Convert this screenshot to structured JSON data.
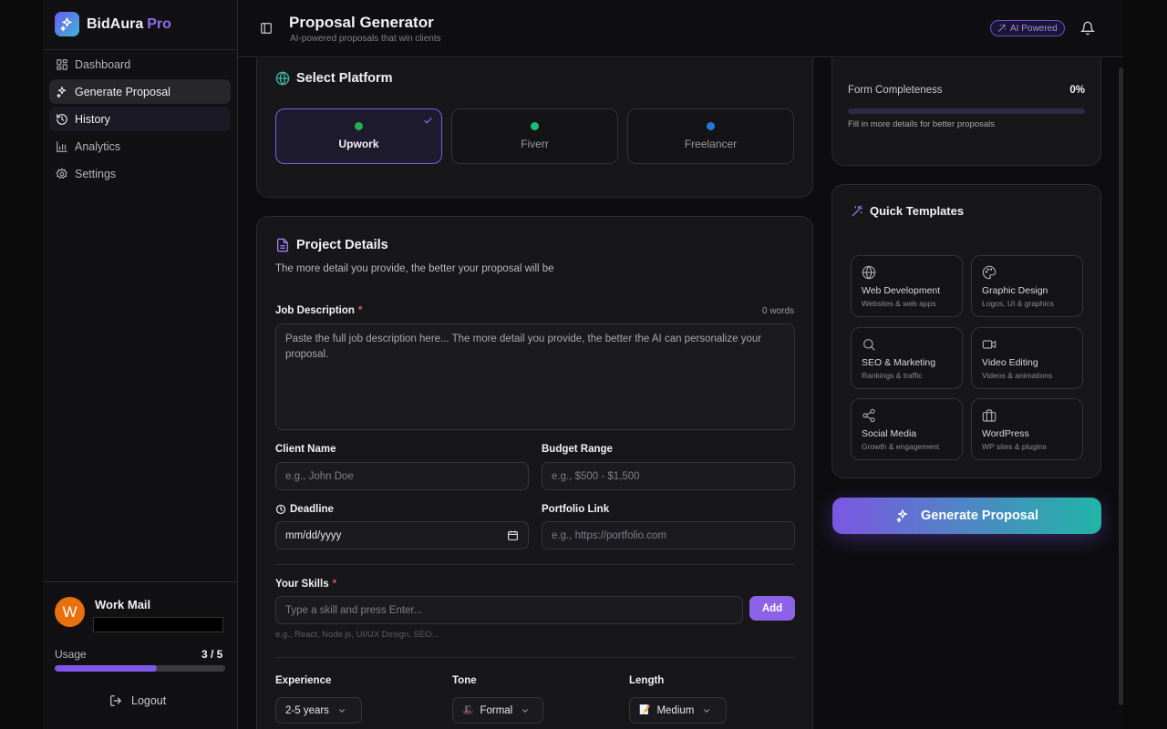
{
  "brand": {
    "name": "BidAura",
    "tier": "Pro"
  },
  "sidebar": {
    "items": [
      {
        "label": "Dashboard",
        "icon": "dashboard-icon"
      },
      {
        "label": "Generate Proposal",
        "icon": "sparkles-icon"
      },
      {
        "label": "History",
        "icon": "history-icon"
      },
      {
        "label": "Analytics",
        "icon": "chart-icon"
      },
      {
        "label": "Settings",
        "icon": "gear-icon"
      }
    ],
    "user": {
      "initial": "W",
      "name": "Work Mail"
    },
    "usage": {
      "label": "Usage",
      "count": "3 / 5",
      "fraction": 0.6
    },
    "logout_label": "Logout"
  },
  "header": {
    "title": "Proposal Generator",
    "subtitle": "AI-powered proposals that win clients",
    "badge": "AI Powered"
  },
  "platform": {
    "title": "Select Platform",
    "options": [
      {
        "label": "Upwork",
        "color": "#22b14c",
        "selected": true
      },
      {
        "label": "Fiverr",
        "color": "#1dbf73",
        "selected": false
      },
      {
        "label": "Freelancer",
        "color": "#1f7cd6",
        "selected": false
      }
    ]
  },
  "project": {
    "title": "Project Details",
    "description": "The more detail you provide, the better your proposal will be",
    "job_description": {
      "label": "Job Description",
      "required_mark": "*",
      "word_count": "0 words",
      "placeholder": "Paste the full job description here... The more detail you provide, the better the AI can personalize your proposal."
    },
    "client_name": {
      "label": "Client Name",
      "placeholder": "e.g., John Doe"
    },
    "budget_range": {
      "label": "Budget Range",
      "placeholder": "e.g., $500 - $1,500"
    },
    "deadline": {
      "label": "Deadline",
      "value": "mm/dd/yyyy"
    },
    "portfolio": {
      "label": "Portfolio Link",
      "placeholder": "e.g., https://portfolio.com"
    },
    "skills": {
      "label": "Your Skills",
      "required_mark": "*",
      "placeholder": "Type a skill and press Enter...",
      "add_label": "Add",
      "hint": "e.g., React, Node.js, UI/UX Design, SEO..."
    },
    "experience": {
      "label": "Experience",
      "value": "2-5 years"
    },
    "tone": {
      "label": "Tone",
      "value": "Formal",
      "emoji": "🎩"
    },
    "length": {
      "label": "Length",
      "value": "Medium",
      "emoji": "📝"
    }
  },
  "completeness": {
    "label": "Form Completeness",
    "value": "0%",
    "fraction": 0,
    "hint": "Fill in more details for better proposals"
  },
  "templates": {
    "title": "Quick Templates",
    "items": [
      {
        "title": "Web Development",
        "subtitle": "Websites & web apps",
        "icon": "globe-icon"
      },
      {
        "title": "Graphic Design",
        "subtitle": "Logos, UI & graphics",
        "icon": "palette-icon"
      },
      {
        "title": "SEO & Marketing",
        "subtitle": "Rankings & traffic",
        "icon": "search-icon"
      },
      {
        "title": "Video Editing",
        "subtitle": "Videos & animations",
        "icon": "video-icon"
      },
      {
        "title": "Social Media",
        "subtitle": "Growth & engagement",
        "icon": "share-icon"
      },
      {
        "title": "WordPress",
        "subtitle": "WP sites & plugins",
        "icon": "briefcase-icon"
      }
    ]
  },
  "generate_button": {
    "label": "Generate Proposal"
  },
  "colors": {
    "accent": "#8e62e8",
    "teal": "#21b5a7",
    "danger": "#e0524f"
  }
}
